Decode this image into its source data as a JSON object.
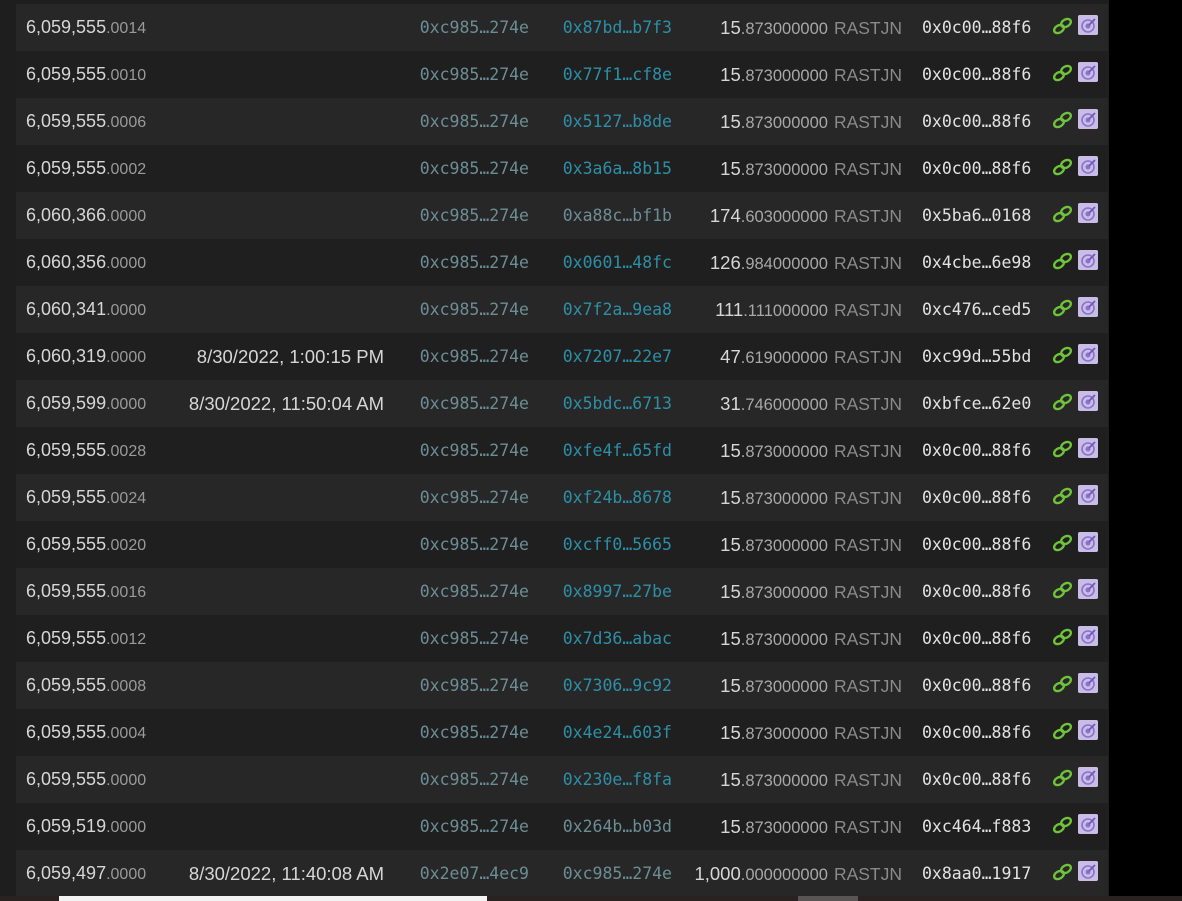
{
  "table": {
    "unit": "RASTJN",
    "rows": [
      {
        "int": "6,059,555",
        "frac": ".0014",
        "time": "",
        "from": "0xc985…274e",
        "to": "0x87bd…b7f3",
        "to_link": true,
        "amt_int": "15",
        "amt_dec": ".873000000",
        "hash": "0x0c00…88f6"
      },
      {
        "int": "6,059,555",
        "frac": ".0010",
        "time": "",
        "from": "0xc985…274e",
        "to": "0x77f1…cf8e",
        "to_link": true,
        "amt_int": "15",
        "amt_dec": ".873000000",
        "hash": "0x0c00…88f6"
      },
      {
        "int": "6,059,555",
        "frac": ".0006",
        "time": "",
        "from": "0xc985…274e",
        "to": "0x5127…b8de",
        "to_link": true,
        "amt_int": "15",
        "amt_dec": ".873000000",
        "hash": "0x0c00…88f6"
      },
      {
        "int": "6,059,555",
        "frac": ".0002",
        "time": "",
        "from": "0xc985…274e",
        "to": "0x3a6a…8b15",
        "to_link": true,
        "amt_int": "15",
        "amt_dec": ".873000000",
        "hash": "0x0c00…88f6"
      },
      {
        "int": "6,060,366",
        "frac": ".0000",
        "time": "",
        "from": "0xc985…274e",
        "to": "0xa88c…bf1b",
        "to_link": false,
        "amt_int": "174",
        "amt_dec": ".603000000",
        "hash": "0x5ba6…0168"
      },
      {
        "int": "6,060,356",
        "frac": ".0000",
        "time": "",
        "from": "0xc985…274e",
        "to": "0x0601…48fc",
        "to_link": true,
        "amt_int": "126",
        "amt_dec": ".984000000",
        "hash": "0x4cbe…6e98"
      },
      {
        "int": "6,060,341",
        "frac": ".0000",
        "time": "",
        "from": "0xc985…274e",
        "to": "0x7f2a…9ea8",
        "to_link": true,
        "amt_int": "111",
        "amt_dec": ".111000000",
        "hash": "0xc476…ced5"
      },
      {
        "int": "6,060,319",
        "frac": ".0000",
        "time": "8/30/2022, 1:00:15 PM",
        "from": "0xc985…274e",
        "to": "0x7207…22e7",
        "to_link": true,
        "amt_int": "47",
        "amt_dec": ".619000000",
        "hash": "0xc99d…55bd"
      },
      {
        "int": "6,059,599",
        "frac": ".0000",
        "time": "8/30/2022, 11:50:04 AM",
        "from": "0xc985…274e",
        "to": "0x5bdc…6713",
        "to_link": true,
        "amt_int": "31",
        "amt_dec": ".746000000",
        "hash": "0xbfce…62e0"
      },
      {
        "int": "6,059,555",
        "frac": ".0028",
        "time": "",
        "from": "0xc985…274e",
        "to": "0xfe4f…65fd",
        "to_link": true,
        "amt_int": "15",
        "amt_dec": ".873000000",
        "hash": "0x0c00…88f6"
      },
      {
        "int": "6,059,555",
        "frac": ".0024",
        "time": "",
        "from": "0xc985…274e",
        "to": "0xf24b…8678",
        "to_link": true,
        "amt_int": "15",
        "amt_dec": ".873000000",
        "hash": "0x0c00…88f6"
      },
      {
        "int": "6,059,555",
        "frac": ".0020",
        "time": "",
        "from": "0xc985…274e",
        "to": "0xcff0…5665",
        "to_link": true,
        "amt_int": "15",
        "amt_dec": ".873000000",
        "hash": "0x0c00…88f6"
      },
      {
        "int": "6,059,555",
        "frac": ".0016",
        "time": "",
        "from": "0xc985…274e",
        "to": "0x8997…27be",
        "to_link": true,
        "amt_int": "15",
        "amt_dec": ".873000000",
        "hash": "0x0c00…88f6"
      },
      {
        "int": "6,059,555",
        "frac": ".0012",
        "time": "",
        "from": "0xc985…274e",
        "to": "0x7d36…abac",
        "to_link": true,
        "amt_int": "15",
        "amt_dec": ".873000000",
        "hash": "0x0c00…88f6"
      },
      {
        "int": "6,059,555",
        "frac": ".0008",
        "time": "",
        "from": "0xc985…274e",
        "to": "0x7306…9c92",
        "to_link": true,
        "amt_int": "15",
        "amt_dec": ".873000000",
        "hash": "0x0c00…88f6"
      },
      {
        "int": "6,059,555",
        "frac": ".0004",
        "time": "",
        "from": "0xc985…274e",
        "to": "0x4e24…603f",
        "to_link": true,
        "amt_int": "15",
        "amt_dec": ".873000000",
        "hash": "0x0c00…88f6"
      },
      {
        "int": "6,059,555",
        "frac": ".0000",
        "time": "",
        "from": "0xc985…274e",
        "to": "0x230e…f8fa",
        "to_link": true,
        "amt_int": "15",
        "amt_dec": ".873000000",
        "hash": "0x0c00…88f6"
      },
      {
        "int": "6,059,519",
        "frac": ".0000",
        "time": "",
        "from": "0xc985…274e",
        "to": "0x264b…b03d",
        "to_link": false,
        "amt_int": "15",
        "amt_dec": ".873000000",
        "hash": "0xc464…f883"
      },
      {
        "int": "6,059,497",
        "frac": ".0000",
        "time": "8/30/2022, 11:40:08 AM",
        "from": "0x2e07…4ec9",
        "to": "0xc985…274e",
        "to_link": false,
        "amt_int": "1,000",
        "amt_dec": ".000000000",
        "hash": "0x8aa0…1917"
      }
    ]
  },
  "icons": {
    "chain_icon": "link-chain-icon",
    "explorer_icon": "block-explorer-icon",
    "chain_color": "#6fc23a",
    "explorer_color": "#c9bde8"
  }
}
